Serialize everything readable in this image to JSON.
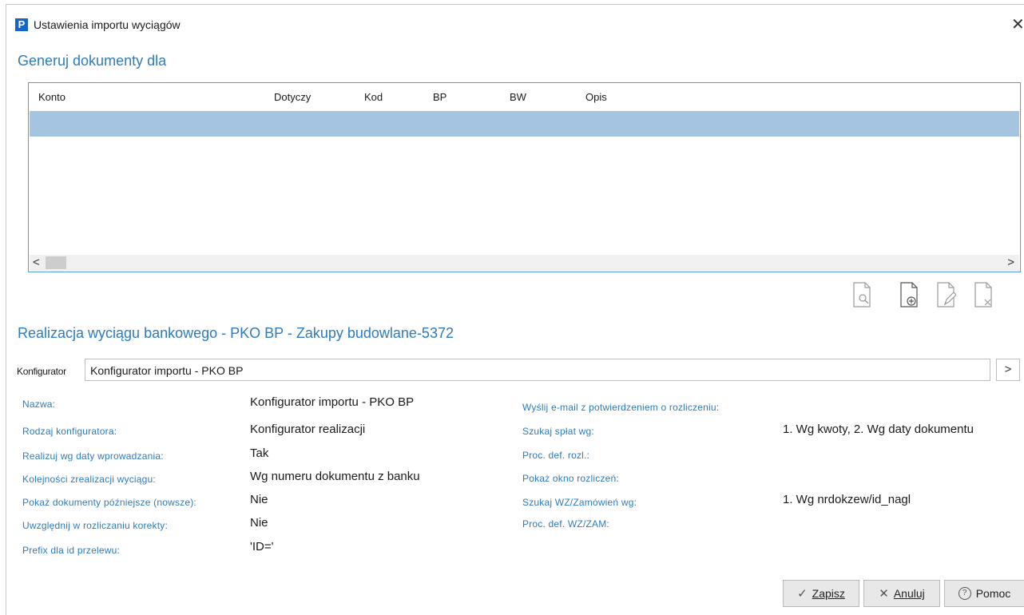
{
  "window": {
    "title": "Ustawienia importu wyciągów",
    "app_icon": "P",
    "close_glyph": "✕"
  },
  "generate": {
    "title": "Generuj dokumenty dla",
    "columns": [
      "Konto",
      "Dotyczy",
      "Kod",
      "BP",
      "BW",
      "Opis"
    ]
  },
  "scroll": {
    "left": "<",
    "right": ">"
  },
  "toolbar_icons": [
    "document-preview-icon",
    "document-add-icon",
    "document-edit-icon",
    "document-delete-icon"
  ],
  "realization": {
    "title": "Realizacja wyciągu bankowego - PKO BP - Zakupy budowlane-5372",
    "konfigurator_label": "Konfigurator",
    "konfigurator_value": "Konfigurator importu - PKO BP",
    "konfigurator_btn": ">"
  },
  "details_left": [
    {
      "label": "Nazwa:",
      "value": "Konfigurator importu - PKO BP"
    },
    {
      "label": "Rodzaj konfiguratora:",
      "value": "Konfigurator realizacji"
    },
    {
      "label": "Realizuj wg daty wprowadzania:",
      "value": "Tak"
    },
    {
      "label": "Kolejności zrealizacji wyciągu:",
      "value": "Wg numeru dokumentu z banku"
    },
    {
      "label": "Pokaż dokumenty późniejsze (nowsze):",
      "value": "Nie"
    },
    {
      "label": "Uwzględnij w rozliczaniu korekty:",
      "value": "Nie"
    },
    {
      "label": "Prefix dla id przelewu:",
      "value": "'ID='"
    }
  ],
  "details_right": [
    {
      "label": "Wyślij e-mail z potwierdzeniem o rozliczeniu:",
      "value": ""
    },
    {
      "label": "Szukaj spłat wg:",
      "value": "1. Wg kwoty, 2. Wg daty dokumentu"
    },
    {
      "label": "Proc. def. rozl.:",
      "value": ""
    },
    {
      "label": "Pokaż okno rozliczeń:",
      "value": ""
    },
    {
      "label": "Szukaj WZ/Zamówień wg:",
      "value": "1. Wg nrdokzew/id_nagl"
    },
    {
      "label": "Proc. def. WZ/ZAM:",
      "value": ""
    }
  ],
  "buttons": {
    "save": {
      "icon": "✓",
      "label": "Zapisz"
    },
    "cancel": {
      "icon": "✕",
      "label": "Anuluj"
    },
    "help": {
      "icon": "?",
      "label": "Pomoc"
    }
  },
  "colors": {
    "accent": "#2f7bbf",
    "selection": "#a4c4e2",
    "grid_border": "#5b9bd5"
  }
}
